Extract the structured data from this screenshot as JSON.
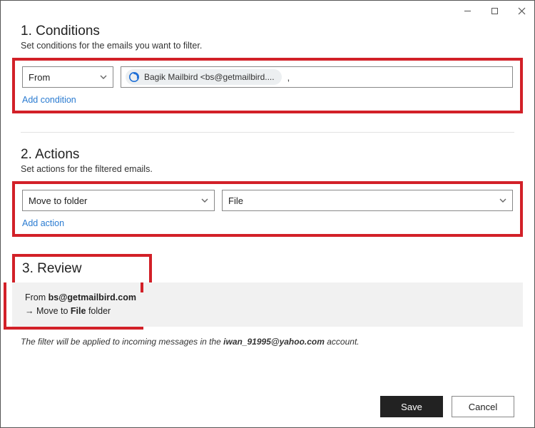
{
  "sections": {
    "conditions": {
      "title": "1. Conditions",
      "subtitle": "Set conditions for the emails you want to filter.",
      "field_dropdown": "From",
      "chip_label": "Bagik Mailbird  <bs@getmailbird....",
      "trailing": ",",
      "add_link": "Add condition"
    },
    "actions": {
      "title": "2. Actions",
      "subtitle": "Set actions for the filtered emails.",
      "action_dropdown": "Move to folder",
      "folder_dropdown": "File",
      "add_link": "Add action"
    },
    "review": {
      "title": "3. Review",
      "line1_prefix": "From ",
      "line1_bold": "bs@getmailbird.com",
      "line2_prefix": "→  Move to ",
      "line2_bold": "File",
      "line2_suffix": " folder"
    }
  },
  "footnote": {
    "prefix": "The filter will be applied to incoming messages in the ",
    "account": "iwan_91995@yahoo.com",
    "suffix": " account."
  },
  "buttons": {
    "save": "Save",
    "cancel": "Cancel"
  }
}
